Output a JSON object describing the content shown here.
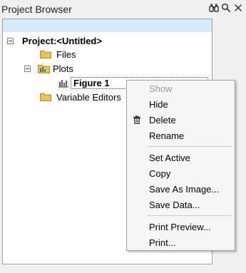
{
  "window": {
    "title": "Project Browser",
    "icons": [
      "binoculars-icon",
      "magnifier-icon",
      "close-icon"
    ]
  },
  "tree": {
    "root_label": "Project:<Untitled>",
    "files_label": "Files",
    "plots_label": "Plots",
    "figure_label": "Figure 1",
    "variable_editors_label": "Variable Editors"
  },
  "context_menu": {
    "items": [
      {
        "label": "Show",
        "enabled": false
      },
      {
        "label": "Hide",
        "enabled": true
      },
      {
        "label": "Delete",
        "enabled": true,
        "icon": "trash-icon"
      },
      {
        "label": "Rename",
        "enabled": true
      },
      {
        "label": "Set Active",
        "enabled": true
      },
      {
        "label": "Copy",
        "enabled": true
      },
      {
        "label": "Save As Image...",
        "enabled": true
      },
      {
        "label": "Save Data...",
        "enabled": true
      },
      {
        "label": "Print Preview...",
        "enabled": true
      },
      {
        "label": "Print...",
        "enabled": true
      }
    ]
  },
  "colors": {
    "search_bar": "#d5ecf8",
    "folder": "#e8c35a",
    "disabled_text": "#9a9a9a"
  }
}
